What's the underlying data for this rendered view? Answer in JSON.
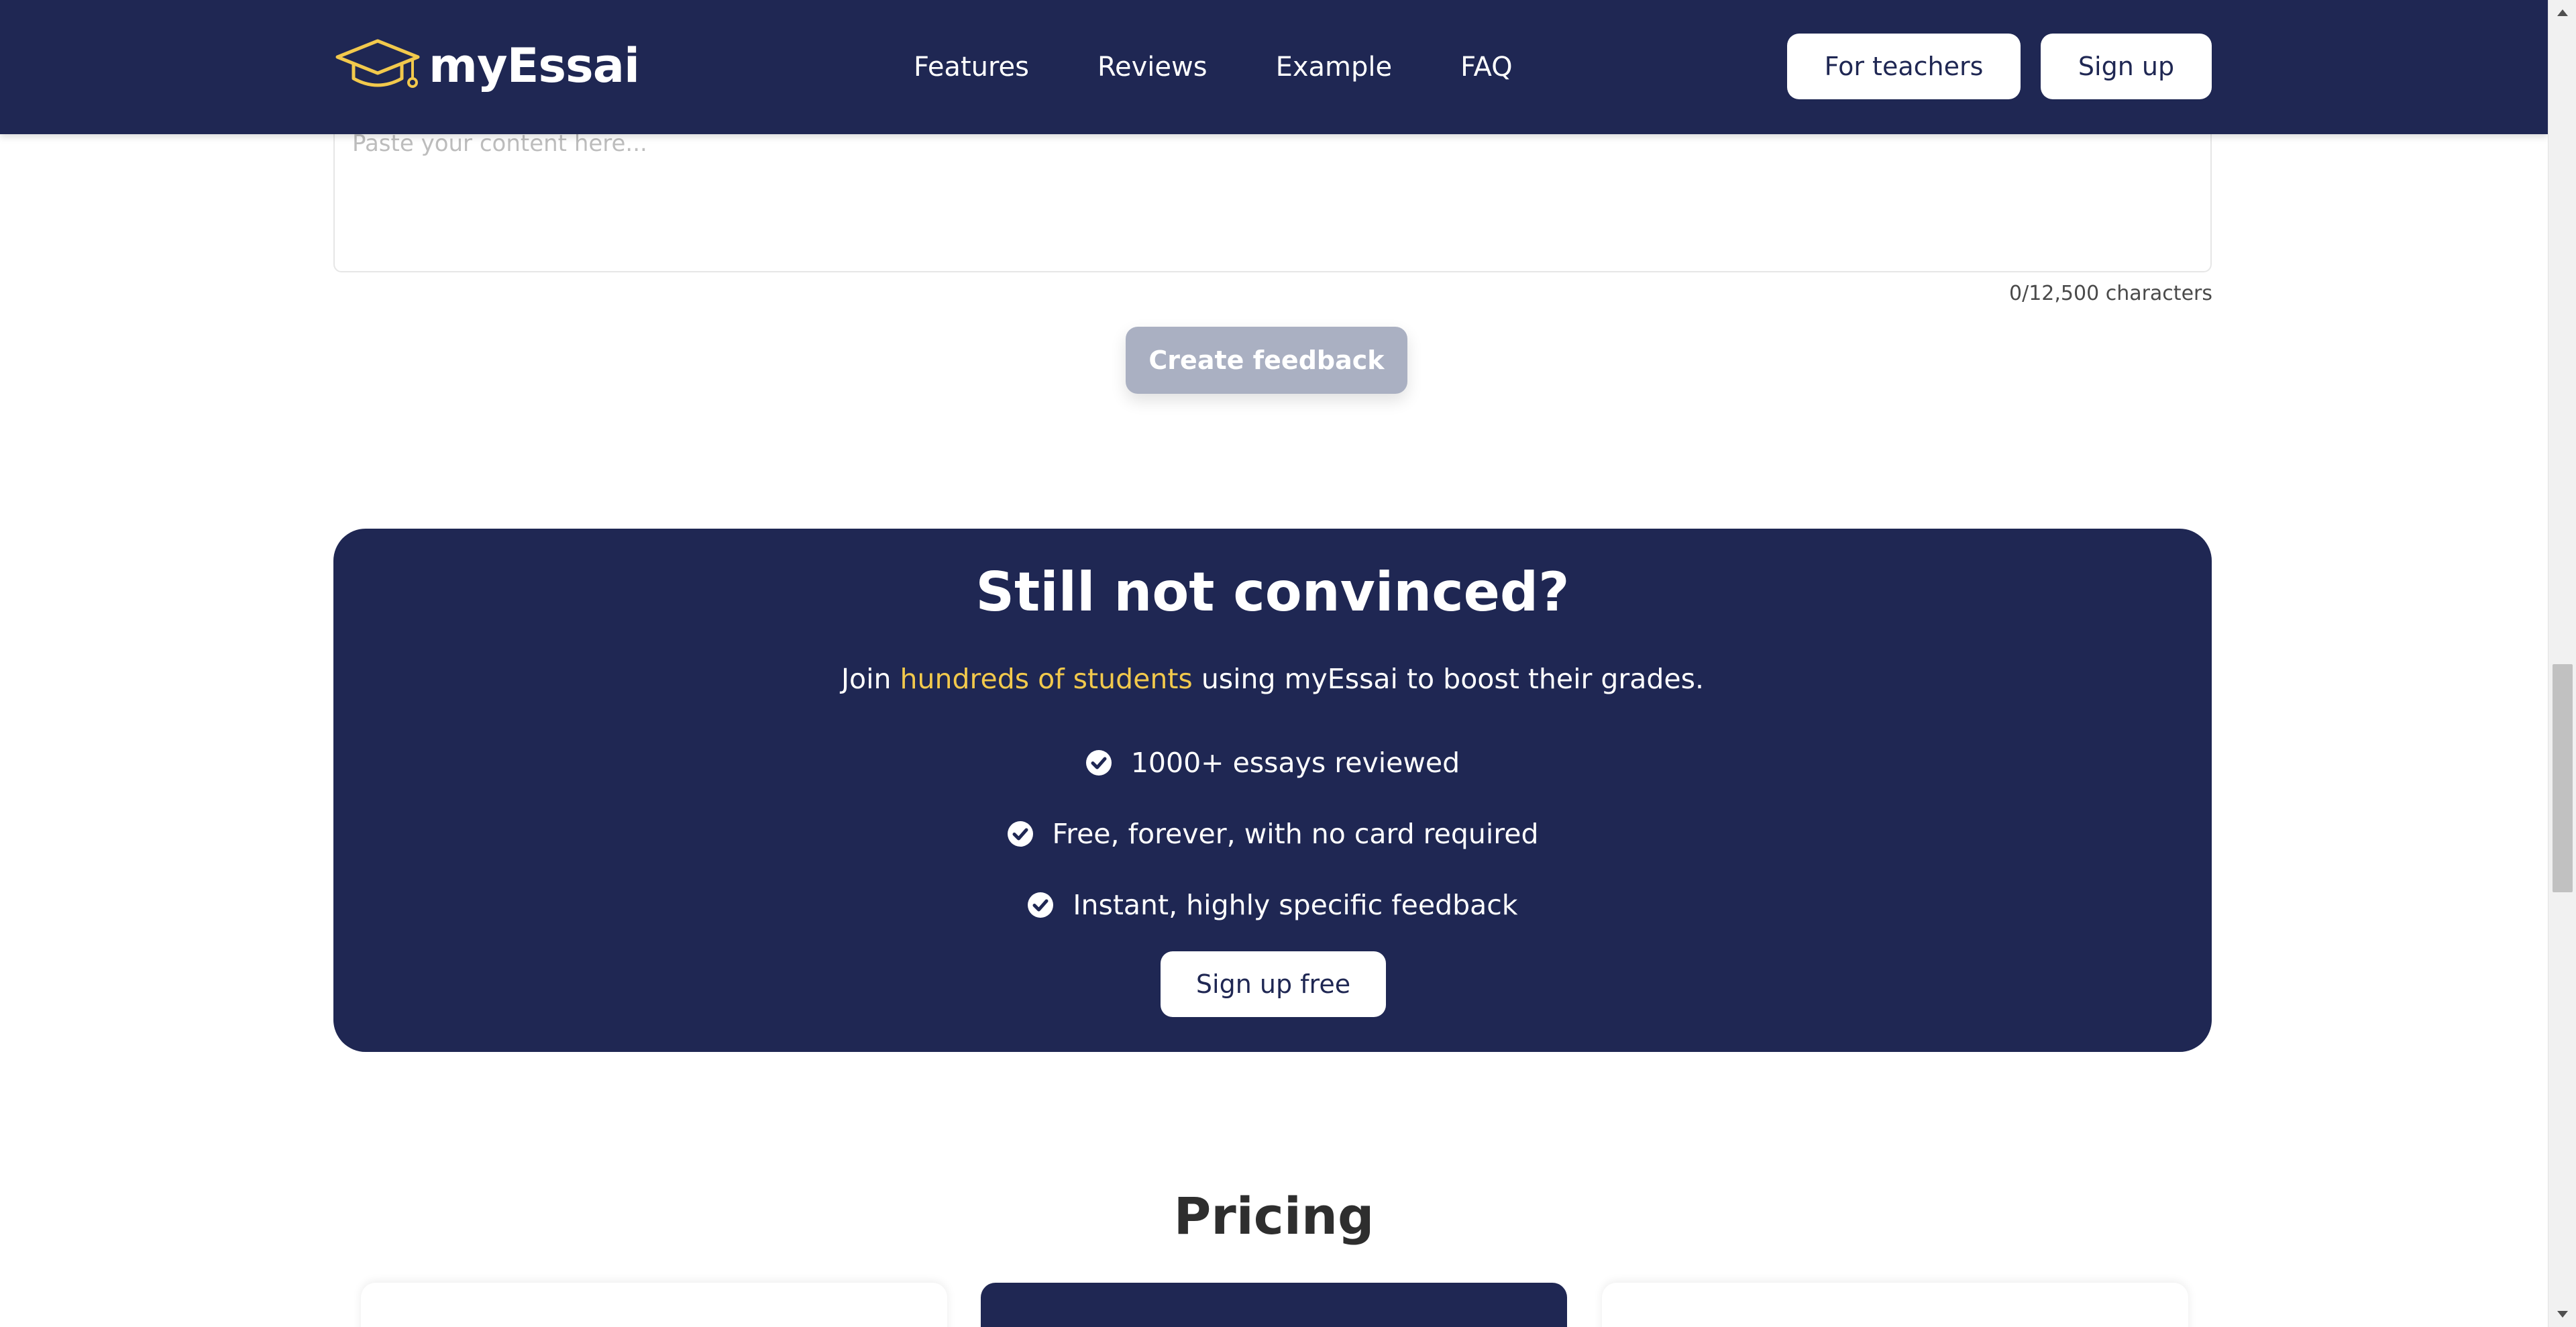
{
  "brand": {
    "name": "myEssai",
    "logo_icon": "graduation-cap-icon",
    "accent": "#f2c94c"
  },
  "nav": {
    "links": [
      "Features",
      "Reviews",
      "Example",
      "FAQ"
    ],
    "teachers_label": "For teachers",
    "signup_label": "Sign up"
  },
  "editor": {
    "placeholder": "Paste your content here...",
    "value": "",
    "char_count": "0/12,500 characters",
    "create_label": "Create feedback"
  },
  "cta": {
    "title": "Still not convinced?",
    "sub_prefix": "Join ",
    "sub_highlight": "hundreds of students",
    "sub_suffix": " using myEssai to boost their grades.",
    "features": [
      "1000+ essays reviewed",
      "Free, forever, with no card required",
      "Instant, highly specific feedback"
    ],
    "check_icon": "check-circle-icon",
    "button_label": "Sign up free"
  },
  "pricing": {
    "title": "Pricing"
  },
  "colors": {
    "navy": "#1f2753",
    "highlight": "#f2c94c",
    "disabled_button": "#aab0c2"
  }
}
